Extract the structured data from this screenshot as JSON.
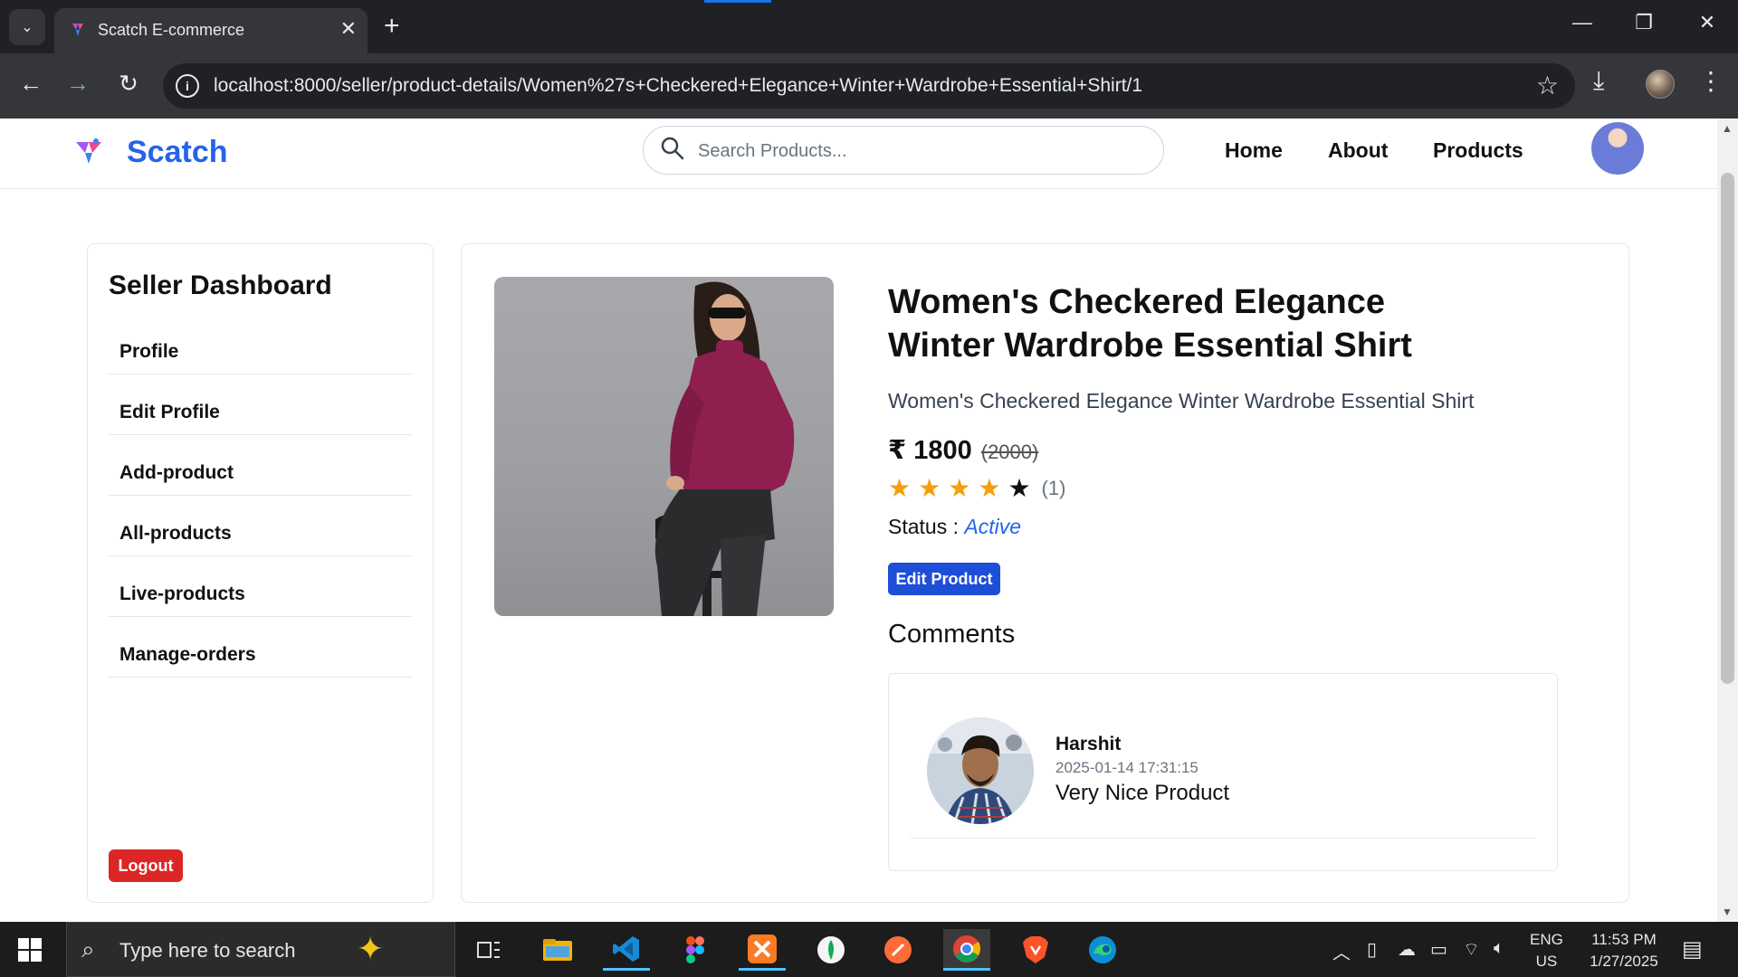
{
  "browser": {
    "tab_title": "Scatch E-commerce",
    "url": "localhost:8000/seller/product-details/Women%27s+Checkered+Elegance+Winter+Wardrobe+Essential+Shirt/1"
  },
  "site": {
    "brand": "Scatch",
    "search_placeholder": "Search Products...",
    "nav": [
      "Home",
      "About",
      "Products"
    ],
    "brand_color": "#2563eb"
  },
  "sidebar": {
    "title": "Seller Dashboard",
    "items": [
      {
        "label": "Profile"
      },
      {
        "label": "Edit Profile"
      },
      {
        "label": "Add-product"
      },
      {
        "label": "All-products"
      },
      {
        "label": "Live-products"
      },
      {
        "label": "Manage-orders"
      }
    ],
    "logout_label": "Logout"
  },
  "product": {
    "title": "Women's Checkered Elegance Winter Wardrobe Essential Shirt",
    "description": "Women's Checkered Elegance Winter Wardrobe Essential Shirt",
    "price": "₹ 1800",
    "old_price": "(2000)",
    "rating": 4,
    "rating_max": 5,
    "rating_count": "(1)",
    "status_label": "Status :",
    "status_value": "Active",
    "edit_label": "Edit Product"
  },
  "comments": {
    "heading": "Comments",
    "items": [
      {
        "user": "Harshit",
        "time": "2025-01-14 17:31:15",
        "text": "Very Nice Product"
      }
    ]
  },
  "taskbar": {
    "search_placeholder": "Type here to search",
    "lang": "ENG",
    "region": "US",
    "time": "11:53 PM",
    "date": "1/27/2025"
  }
}
